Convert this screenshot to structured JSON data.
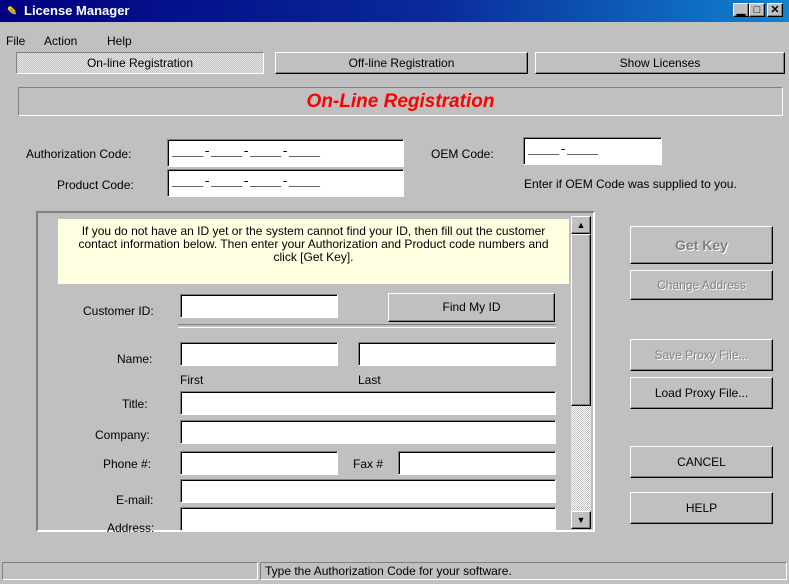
{
  "window": {
    "title": "License Manager",
    "icon": "license-manager-app-icon",
    "controls": {
      "minimize": "▁",
      "maximize": "□",
      "close": "✕"
    }
  },
  "menu": {
    "file": "File",
    "action": "Action",
    "help": "Help"
  },
  "tabs": [
    {
      "label": "On-line Registration",
      "active": true
    },
    {
      "label": "Off-line Registration",
      "active": false
    },
    {
      "label": "Show Licenses",
      "active": false
    }
  ],
  "banner": {
    "title": "On-Line Registration",
    "color": "#ff0000"
  },
  "codes": {
    "authorization_label": "Authorization Code:",
    "authorization_value": "____-____-____-____",
    "product_label": "Product Code:",
    "product_value": "____-____-____-____",
    "oem_label": "OEM Code:",
    "oem_value": "____-____",
    "oem_hint": "Enter if OEM Code was supplied to you."
  },
  "form": {
    "note": "If you do not have an ID yet or the system cannot find your ID, then fill out the customer contact information below.  Then enter your Authorization and Product code numbers and click [Get Key].",
    "note_color": "#ffffe1",
    "customer_id_label": "Customer ID:",
    "find_id_button": "Find My ID",
    "name_label": "Name:",
    "first_label": "First",
    "last_label": "Last",
    "title_label": "Title:",
    "company_label": "Company:",
    "phone_label": "Phone #:",
    "fax_label": "Fax #",
    "email_label": "E-mail:",
    "address_label": "Address:"
  },
  "side_buttons": {
    "get_key": "Get Key",
    "change_address": "Change Address",
    "save_proxy": "Save Proxy File...",
    "load_proxy": "Load Proxy File...",
    "cancel": "CANCEL",
    "help": "HELP"
  },
  "status": {
    "message": "Type the Authorization Code for your software."
  }
}
